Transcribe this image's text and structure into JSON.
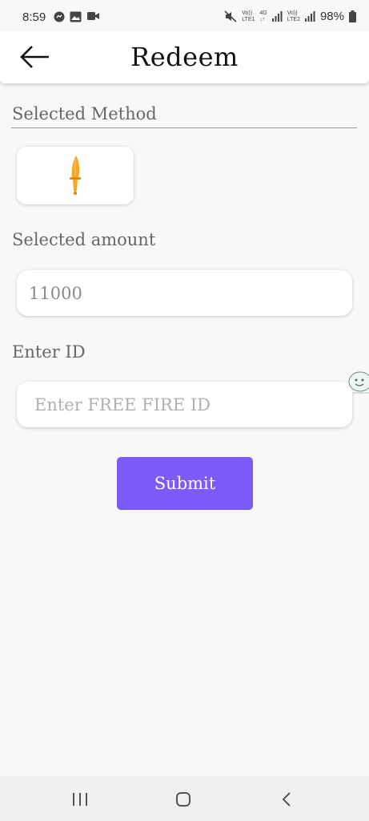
{
  "status_bar": {
    "time": "8:59",
    "sim1_top": "Vo))",
    "sim1_bottom": "LTE1",
    "net_top": "4G",
    "net_bottom": "↓↑",
    "sim2_top": "Vo))",
    "sim2_bottom": "LTE2",
    "battery": "98%",
    "icons": [
      "messenger-icon",
      "gallery-icon",
      "video-icon",
      "mute-icon",
      "signal-icon",
      "battery-icon"
    ]
  },
  "appbar": {
    "title": "Redeem",
    "back_icon": "arrow-left-icon"
  },
  "form": {
    "method_label": "Selected Method",
    "method_icon": "knife-icon",
    "amount_label": "Selected amount",
    "amount_value": "11000",
    "id_label": "Enter ID",
    "id_placeholder": "Enter FREE FIRE ID",
    "id_value": "",
    "submit_label": "Submit"
  },
  "colors": {
    "accent": "#7b5cfa",
    "knife": "#f6a623",
    "background": "#f8f8f8"
  },
  "navbar": {
    "icons": [
      "recents-icon",
      "home-icon",
      "back-icon"
    ]
  }
}
